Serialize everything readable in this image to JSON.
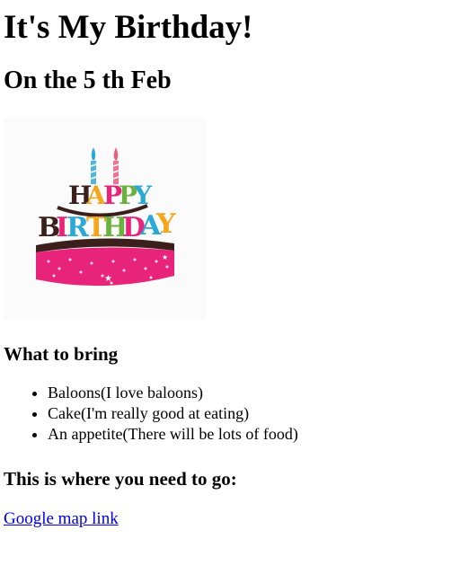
{
  "page": {
    "title": "It's My Birthday!",
    "date_heading": "On the 5 th Feb"
  },
  "image": {
    "description_name": "happy-birthday-cake"
  },
  "bring": {
    "heading": "What to bring",
    "items": [
      "Baloons(I love baloons)",
      "Cake(I'm really good at eating)",
      "An appetite(There will be lots of food)"
    ]
  },
  "location": {
    "heading": "This is where you need to go:",
    "link_text": "Google map link"
  },
  "colors": {
    "link": "#0000ee",
    "cake_pink": "#e8247a",
    "cake_dark": "#3a1f1a"
  }
}
